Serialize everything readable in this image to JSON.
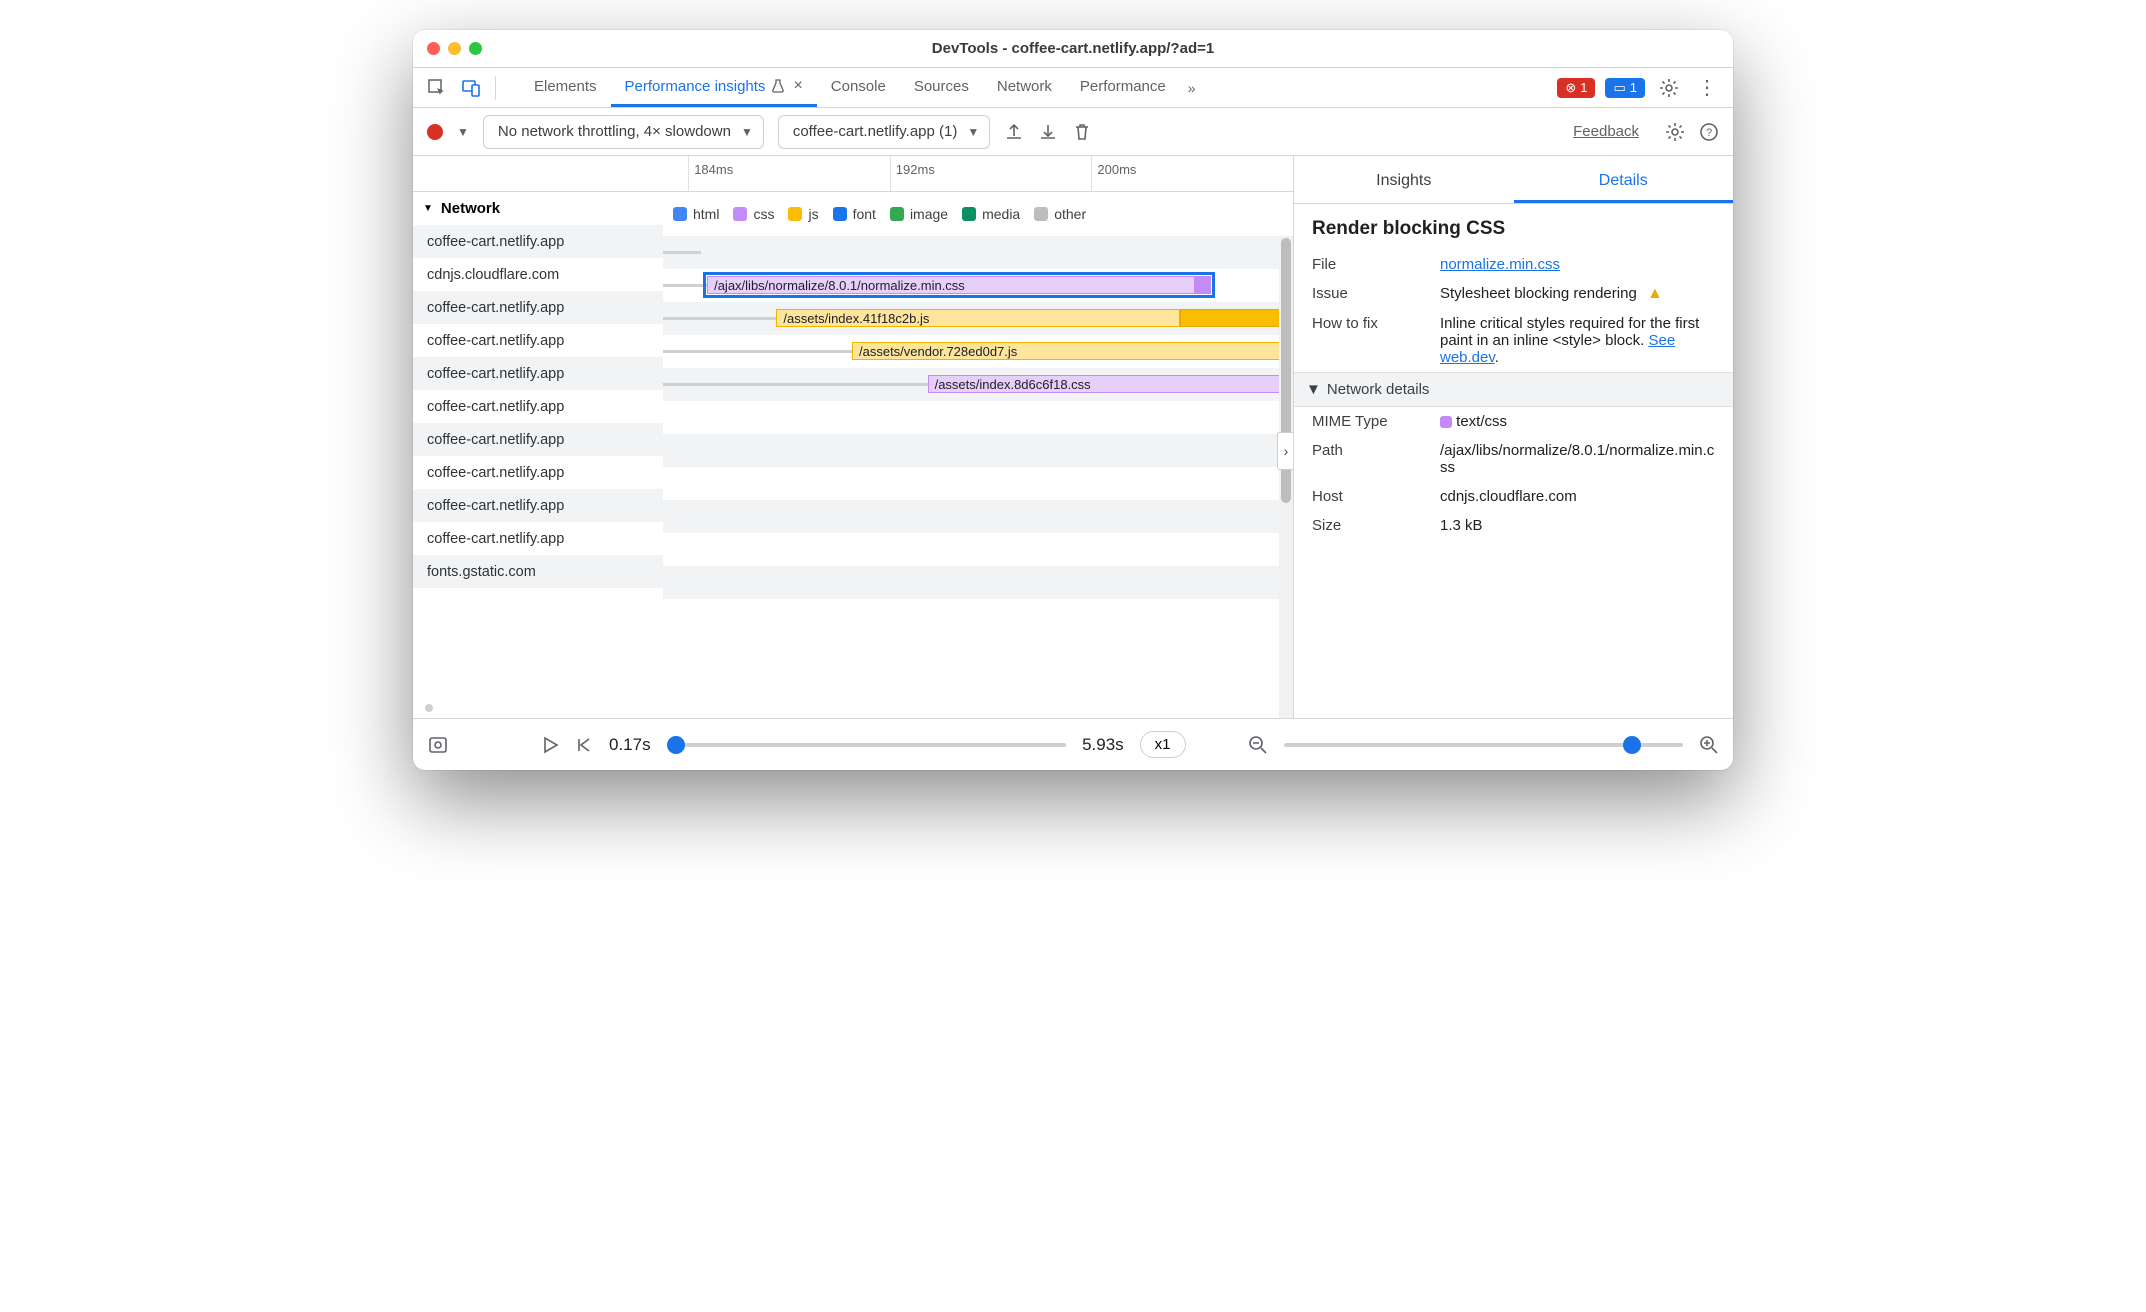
{
  "window": {
    "title": "DevTools - coffee-cart.netlify.app/?ad=1"
  },
  "topTabs": {
    "elements": "Elements",
    "performance_insights": "Performance insights",
    "console": "Console",
    "sources": "Sources",
    "network": "Network",
    "performance": "Performance"
  },
  "badges": {
    "error_count": "1",
    "info_count": "1"
  },
  "toolbar": {
    "throttle": "No network throttling, 4× slowdown",
    "target": "coffee-cart.netlify.app (1)",
    "feedback": "Feedback"
  },
  "ruler": {
    "t1": "184ms",
    "t2": "192ms",
    "t3": "200ms"
  },
  "legend": {
    "html": "html",
    "css": "css",
    "js": "js",
    "font": "font",
    "image": "image",
    "media": "media",
    "other": "other"
  },
  "networkHeader": "Network",
  "hosts": [
    "coffee-cart.netlify.app",
    "cdnjs.cloudflare.com",
    "coffee-cart.netlify.app",
    "coffee-cart.netlify.app",
    "coffee-cart.netlify.app",
    "coffee-cart.netlify.app",
    "coffee-cart.netlify.app",
    "coffee-cart.netlify.app",
    "coffee-cart.netlify.app",
    "coffee-cart.netlify.app",
    "fonts.gstatic.com"
  ],
  "bars": {
    "normalize": "/ajax/libs/normalize/8.0.1/normalize.min.css",
    "indexjs": "/assets/index.41f18c2b.js",
    "vendorjs": "/assets/vendor.728ed0d7.js",
    "indexcss": "/assets/index.8d6c6f18.css"
  },
  "rightTabs": {
    "insights": "Insights",
    "details": "Details"
  },
  "details": {
    "panel_title": "Render blocking CSS",
    "file_label": "File",
    "file_link": "normalize.min.css",
    "issue_label": "Issue",
    "issue_text": "Stylesheet blocking rendering",
    "howto_label": "How to fix",
    "howto_text": "Inline critical styles required for the first paint in an inline <style> block. ",
    "howto_link": "See web.dev",
    "network_details_hdr": "Network details",
    "mime_label": "MIME Type",
    "mime_value": "text/css",
    "path_label": "Path",
    "path_value": "/ajax/libs/normalize/8.0.1/normalize.min.css",
    "host_label": "Host",
    "host_value": "cdnjs.cloudflare.com",
    "size_label": "Size",
    "size_value": "1.3 kB"
  },
  "bottom": {
    "time_start": "0.17s",
    "time_end": "5.93s",
    "speed": "x1"
  }
}
